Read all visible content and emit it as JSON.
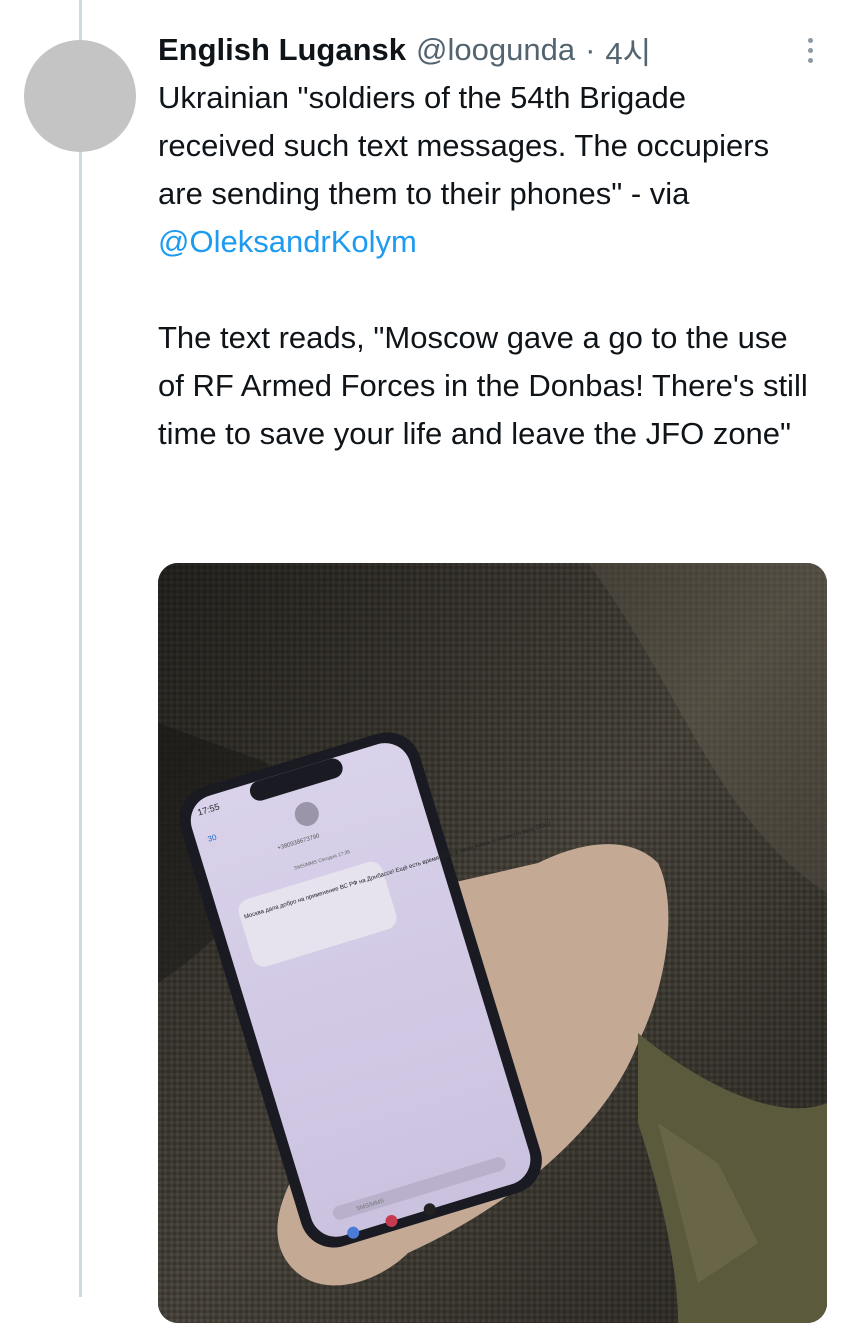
{
  "tweet": {
    "author_name": "English Lugansk",
    "author_handle": "@loogunda",
    "separator": "·",
    "time": "4시",
    "text_line1": "Ukrainian \"soldiers of the 54th Brigade received such text messages. The occupiers are sending them to their phones\" - via",
    "mention": "@OleksandrKolym",
    "text_line2": "The text reads, \"Moscow gave a go to the use of RF Armed Forces in the Donbas! There's still time to save your life and leave the JFO zone\""
  },
  "photo": {
    "status_time": "17:55",
    "back_count": "30",
    "sender_number": "+380938673790",
    "sms_meta": "SMS/MMS\nСегодня 17:35",
    "message": "Москва дала добро на применение ВС РФ на Донбассе! Ещё есть время спасти свою жизнь и покинуть зону ООС!",
    "input_placeholder": "SMS/MMS"
  }
}
